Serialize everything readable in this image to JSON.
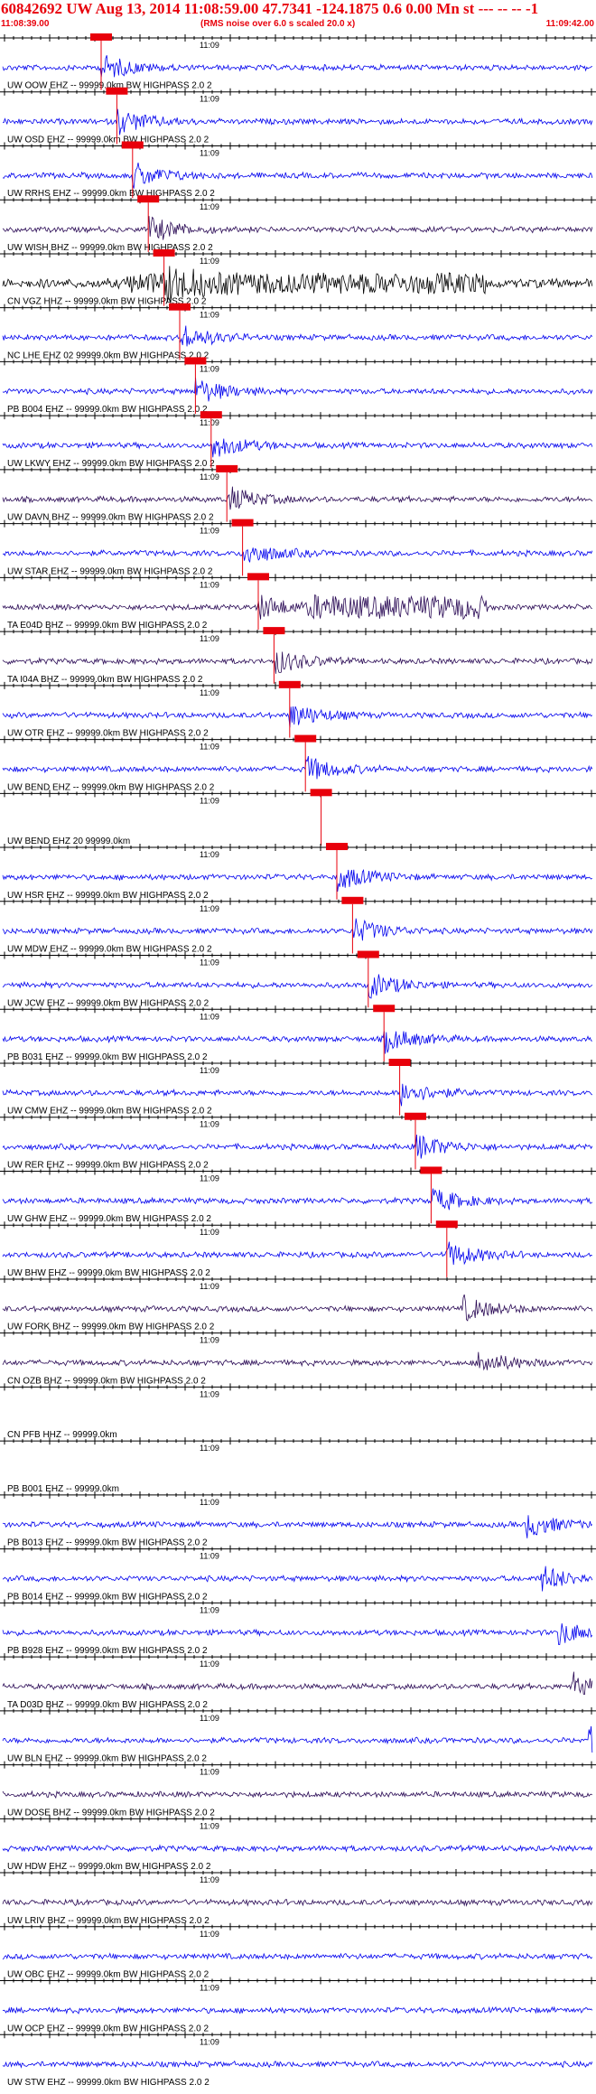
{
  "header": {
    "title": "60842692 UW Aug 13, 2014 11:08:59.00   47.7341 -124.1875  0.6 0.00 Mn st --- -- --  -1",
    "start_time": "11:08:39.00",
    "rms_note": "(RMS noise over 6.0 s scaled 20.0 x)",
    "end_time": "11:09:42.00"
  },
  "time_label": "11:09",
  "colors": {
    "header_text": "#e8000b",
    "pick": "#e8000b",
    "trace_blue": "#0000ee",
    "trace_dark": "#2a0a55",
    "trace_black": "#000000"
  },
  "traces": [
    {
      "label": "UW OOW EHZ -- 99999.0km BW  HIGHPASS  2.0  2",
      "pick": "",
      "color": "blue"
    },
    {
      "label": "UW OSD EHZ -- 99999.0km BW  HIGHPASS  2.0  2",
      "pick": "",
      "color": "blue"
    },
    {
      "label": "UW RRHS EHZ -- 99999.0km BW  HIGHPASS  2.0  2",
      "pick": "",
      "color": "blue"
    },
    {
      "label": "UW WISH BHZ -- 99999.0km BW  HIGHPASS  2.0  2",
      "pick": "",
      "color": "dark"
    },
    {
      "label": "CN VGZ HHZ -- 99999.0km BW  HIGHPASS  2.0  2",
      "pick": "",
      "color": "black"
    },
    {
      "label": "NC LHE EHZ 02 99999.0km BW  HIGHPASS  2.0  2",
      "pick": "",
      "color": "blue"
    },
    {
      "label": "PB B004 EHZ -- 99999.0km BW  HIGHPASS  2.0  2",
      "pick": "",
      "color": "blue"
    },
    {
      "label": "UW LKWY EHZ -- 99999.0km BW  HIGHPASS  2.0  2",
      "pick": "",
      "color": "blue"
    },
    {
      "label": "UW DAVN BHZ -- 99999.0km BW  HIGHPASS  2.0  2",
      "pick": "",
      "color": "dark"
    },
    {
      "label": "UW STAR EHZ -- 99999.0km BW  HIGHPASS  2.0  2",
      "pick": "",
      "color": "blue"
    },
    {
      "label": "TA E04D BHZ -- 99999.0km BW  HIGHPASS  2.0  2",
      "pick": "",
      "color": "dark"
    },
    {
      "label": "TA I04A BHZ -- 99999.0km BW  HIGHPASS  2.0  2",
      "pick": "",
      "color": "dark"
    },
    {
      "label": "UW OTR EHZ -- 99999.0km BW  HIGHPASS  2.0  2",
      "pick": "",
      "color": "blue"
    },
    {
      "label": "UW BEND EHZ -- 99999.0km BW  HIGHPASS  2.0  2",
      "pick": "",
      "color": "blue"
    },
    {
      "label": "UW BEND EHZ 20 99999.0km",
      "pick": "",
      "color": "none"
    },
    {
      "label": "UW HSR EHZ -- 99999.0km BW  HIGHPASS  2.0  2",
      "pick": "",
      "color": "blue"
    },
    {
      "label": "UW MDW EHZ -- 99999.0km BW  HIGHPASS  2.0  2",
      "pick": "",
      "color": "blue"
    },
    {
      "label": "UW JCW EHZ -- 99999.0km BW  HIGHPASS  2.0  2",
      "pick": "",
      "color": "blue"
    },
    {
      "label": "PB B031 EHZ -- 99999.0km BW  HIGHPASS  2.0  2",
      "pick": "",
      "color": "blue"
    },
    {
      "label": "UW CMW EHZ -- 99999.0km BW  HIGHPASS  2.0  2",
      "pick": "",
      "color": "blue"
    },
    {
      "label": "UW RER EHZ -- 99999.0km BW  HIGHPASS  2.0  2",
      "pick": "",
      "color": "blue"
    },
    {
      "label": "UW GHW EHZ -- 99999.0km BW  HIGHPASS  2.0  2",
      "pick": "",
      "color": "blue"
    },
    {
      "label": "UW BHW EHZ -- 99999.0km BW  HIGHPASS  2.0  2",
      "pick": "",
      "color": "blue"
    },
    {
      "label": "UW FORK BHZ -- 99999.0km BW  HIGHPASS  2.0  2",
      "pick": "",
      "color": "dark"
    },
    {
      "label": "CN OZB BHZ -- 99999.0km BW  HIGHPASS  2.0  2",
      "pick": "",
      "color": "dark"
    },
    {
      "label": "CN PFB HHZ -- 99999.0km",
      "pick": "",
      "color": "none"
    },
    {
      "label": "PB B001 EHZ -- 99999.0km",
      "pick": "",
      "color": "none"
    },
    {
      "label": "PB B013 EHZ -- 99999.0km BW  HIGHPASS  2.0  2",
      "pick": "",
      "color": "blue"
    },
    {
      "label": "PB B014 EHZ -- 99999.0km BW  HIGHPASS  2.0  2",
      "pick": "",
      "color": "blue"
    },
    {
      "label": "PB B928 EHZ -- 99999.0km BW  HIGHPASS  2.0  2",
      "pick": "",
      "color": "blue"
    },
    {
      "label": "TA D03D BHZ -- 99999.0km BW  HIGHPASS  2.0  2",
      "pick": "",
      "color": "dark"
    },
    {
      "label": "UW BLN EHZ -- 99999.0km BW  HIGHPASS  2.0  2",
      "pick": "",
      "color": "blue"
    },
    {
      "label": "UW DOSE BHZ -- 99999.0km BW  HIGHPASS  2.0  2",
      "pick": "",
      "color": "dark"
    },
    {
      "label": "UW HDW EHZ -- 99999.0km BW  HIGHPASS  2.0  2",
      "pick": "",
      "color": "blue"
    },
    {
      "label": "UW LRIV BHZ -- 99999.0km BW  HIGHPASS  2.0  2",
      "pick": "",
      "color": "dark"
    },
    {
      "label": "UW OBC EHZ -- 99999.0km BW  HIGHPASS  2.0  2",
      "pick": "",
      "color": "blue"
    },
    {
      "label": "UW OCP EHZ -- 99999.0km BW  HIGHPASS  2.0  2",
      "pick": "",
      "color": "blue"
    },
    {
      "label": "UW STW EHZ -- 99999.0km BW  HIGHPASS  2.0  2",
      "pick": "",
      "color": "blue"
    }
  ]
}
